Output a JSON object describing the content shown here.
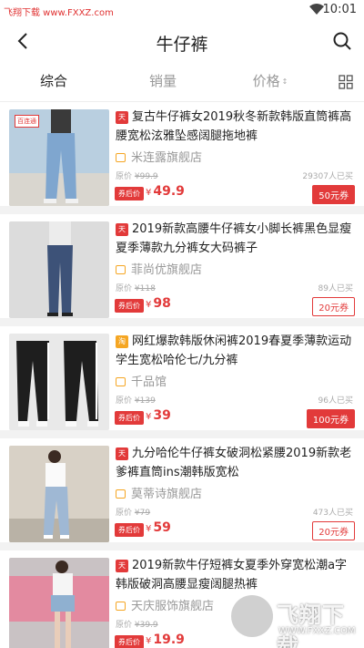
{
  "status_bar": {
    "watermark": "飞翔下载 www.FXXZ.com",
    "time": "10:01"
  },
  "nav": {
    "title": "牛仔裤"
  },
  "tabs": [
    {
      "label": "综合",
      "active": true
    },
    {
      "label": "销量",
      "active": false
    },
    {
      "label": "价格",
      "active": false,
      "sort_arrows": "↕"
    }
  ],
  "products": [
    {
      "shop_tag": "百连通",
      "tm": "天猫",
      "title": "复古牛仔裤女2019秋冬新款韩版直筒裤高腰宽松泫雅坠感阔腿拖地裤",
      "store": "米连露旗舰店",
      "orig_label": "原价",
      "orig_price": "¥99.9",
      "sold": "29307人已买",
      "badge": "券后价",
      "currency": "¥",
      "price": "49.9",
      "coupon": "50元券",
      "coupon_solid": true
    },
    {
      "tm": "天猫",
      "title": "2019新款高腰牛仔裤女小脚长裤黑色显瘦夏季薄款九分裤女大码裤子",
      "store": "菲尚优旗舰店",
      "orig_label": "原价",
      "orig_price": "¥118",
      "sold": "89人已买",
      "badge": "券后价",
      "currency": "¥",
      "price": "98",
      "coupon": "20元券",
      "coupon_solid": false
    },
    {
      "tm": "淘",
      "title": "网红爆款韩版休闲裤2019春夏季薄款运动学生宽松哈伦七/九分裤",
      "store": "千品馆",
      "orig_label": "原价",
      "orig_price": "¥139",
      "sold": "96人已买",
      "badge": "券后价",
      "currency": "¥",
      "price": "39",
      "coupon": "100元券",
      "coupon_solid": true
    },
    {
      "tm": "天猫",
      "title": "九分哈伦牛仔裤女破洞松紧腰2019新款老爹裤直筒ins潮韩版宽松",
      "store": "莫蒂诗旗舰店",
      "orig_label": "原价",
      "orig_price": "¥79",
      "sold": "473人已买",
      "badge": "券后价",
      "currency": "¥",
      "price": "59",
      "coupon": "20元券",
      "coupon_solid": false
    },
    {
      "tm": "天猫",
      "title": "2019新款牛仔短裤女夏季外穿宽松潮a字韩版破洞高腰显瘦阔腿热裤",
      "store": "天庆服饰旗舰店",
      "orig_label": "原价",
      "orig_price": "¥39.9",
      "sold": "",
      "badge": "券后价",
      "currency": "¥",
      "price": "19.9",
      "coupon": "",
      "coupon_solid": false
    }
  ],
  "watermark_logo": {
    "big": "飞翔下载",
    "small": "WWW.FXXZ.COM"
  },
  "colors": {
    "accent": "#e23a3a",
    "store_icon": "#f5a623"
  }
}
